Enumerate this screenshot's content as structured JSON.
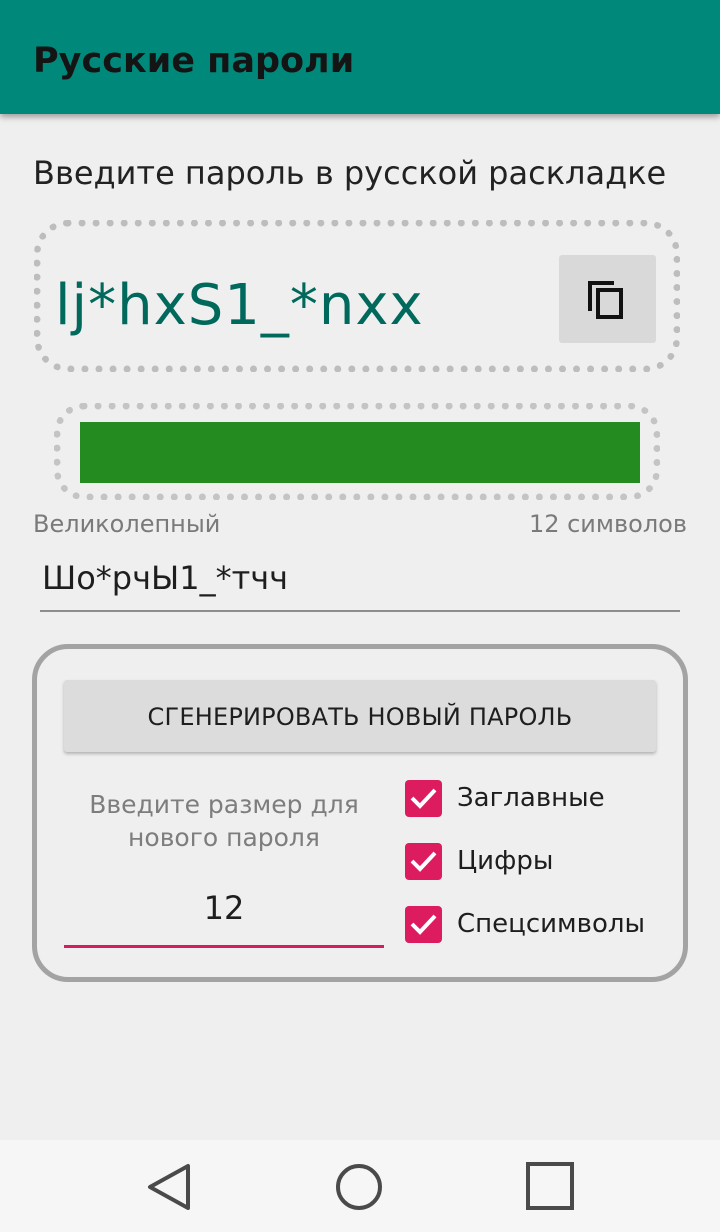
{
  "app": {
    "title": "Русские пароли"
  },
  "main": {
    "instruction": "Введите пароль в русской раскладке",
    "password": "lj*hxS1_*nxx",
    "strength": {
      "label": "Великолепный",
      "level_fraction": 1.0,
      "color": "#238b1f"
    },
    "length_label": "12 символов",
    "translit_value": "Шо*рчЫ1_*тчч"
  },
  "generator": {
    "generate_label": "СГЕНЕРИРОВАТЬ НОВЫЙ ПАРОЛЬ",
    "size_hint": "Введите размер для нового пароля",
    "size_value": "12",
    "options": [
      {
        "label": "Заглавные",
        "checked": true
      },
      {
        "label": "Цифры",
        "checked": true
      },
      {
        "label": "Спецсимволы",
        "checked": true
      }
    ]
  },
  "colors": {
    "appbar": "#00897b",
    "password_text": "#00695c",
    "accent": "#dd1c60"
  },
  "icons": {
    "copy": "copy-icon",
    "back": "back-triangle-icon",
    "home": "home-circle-icon",
    "recents": "recents-square-icon"
  }
}
